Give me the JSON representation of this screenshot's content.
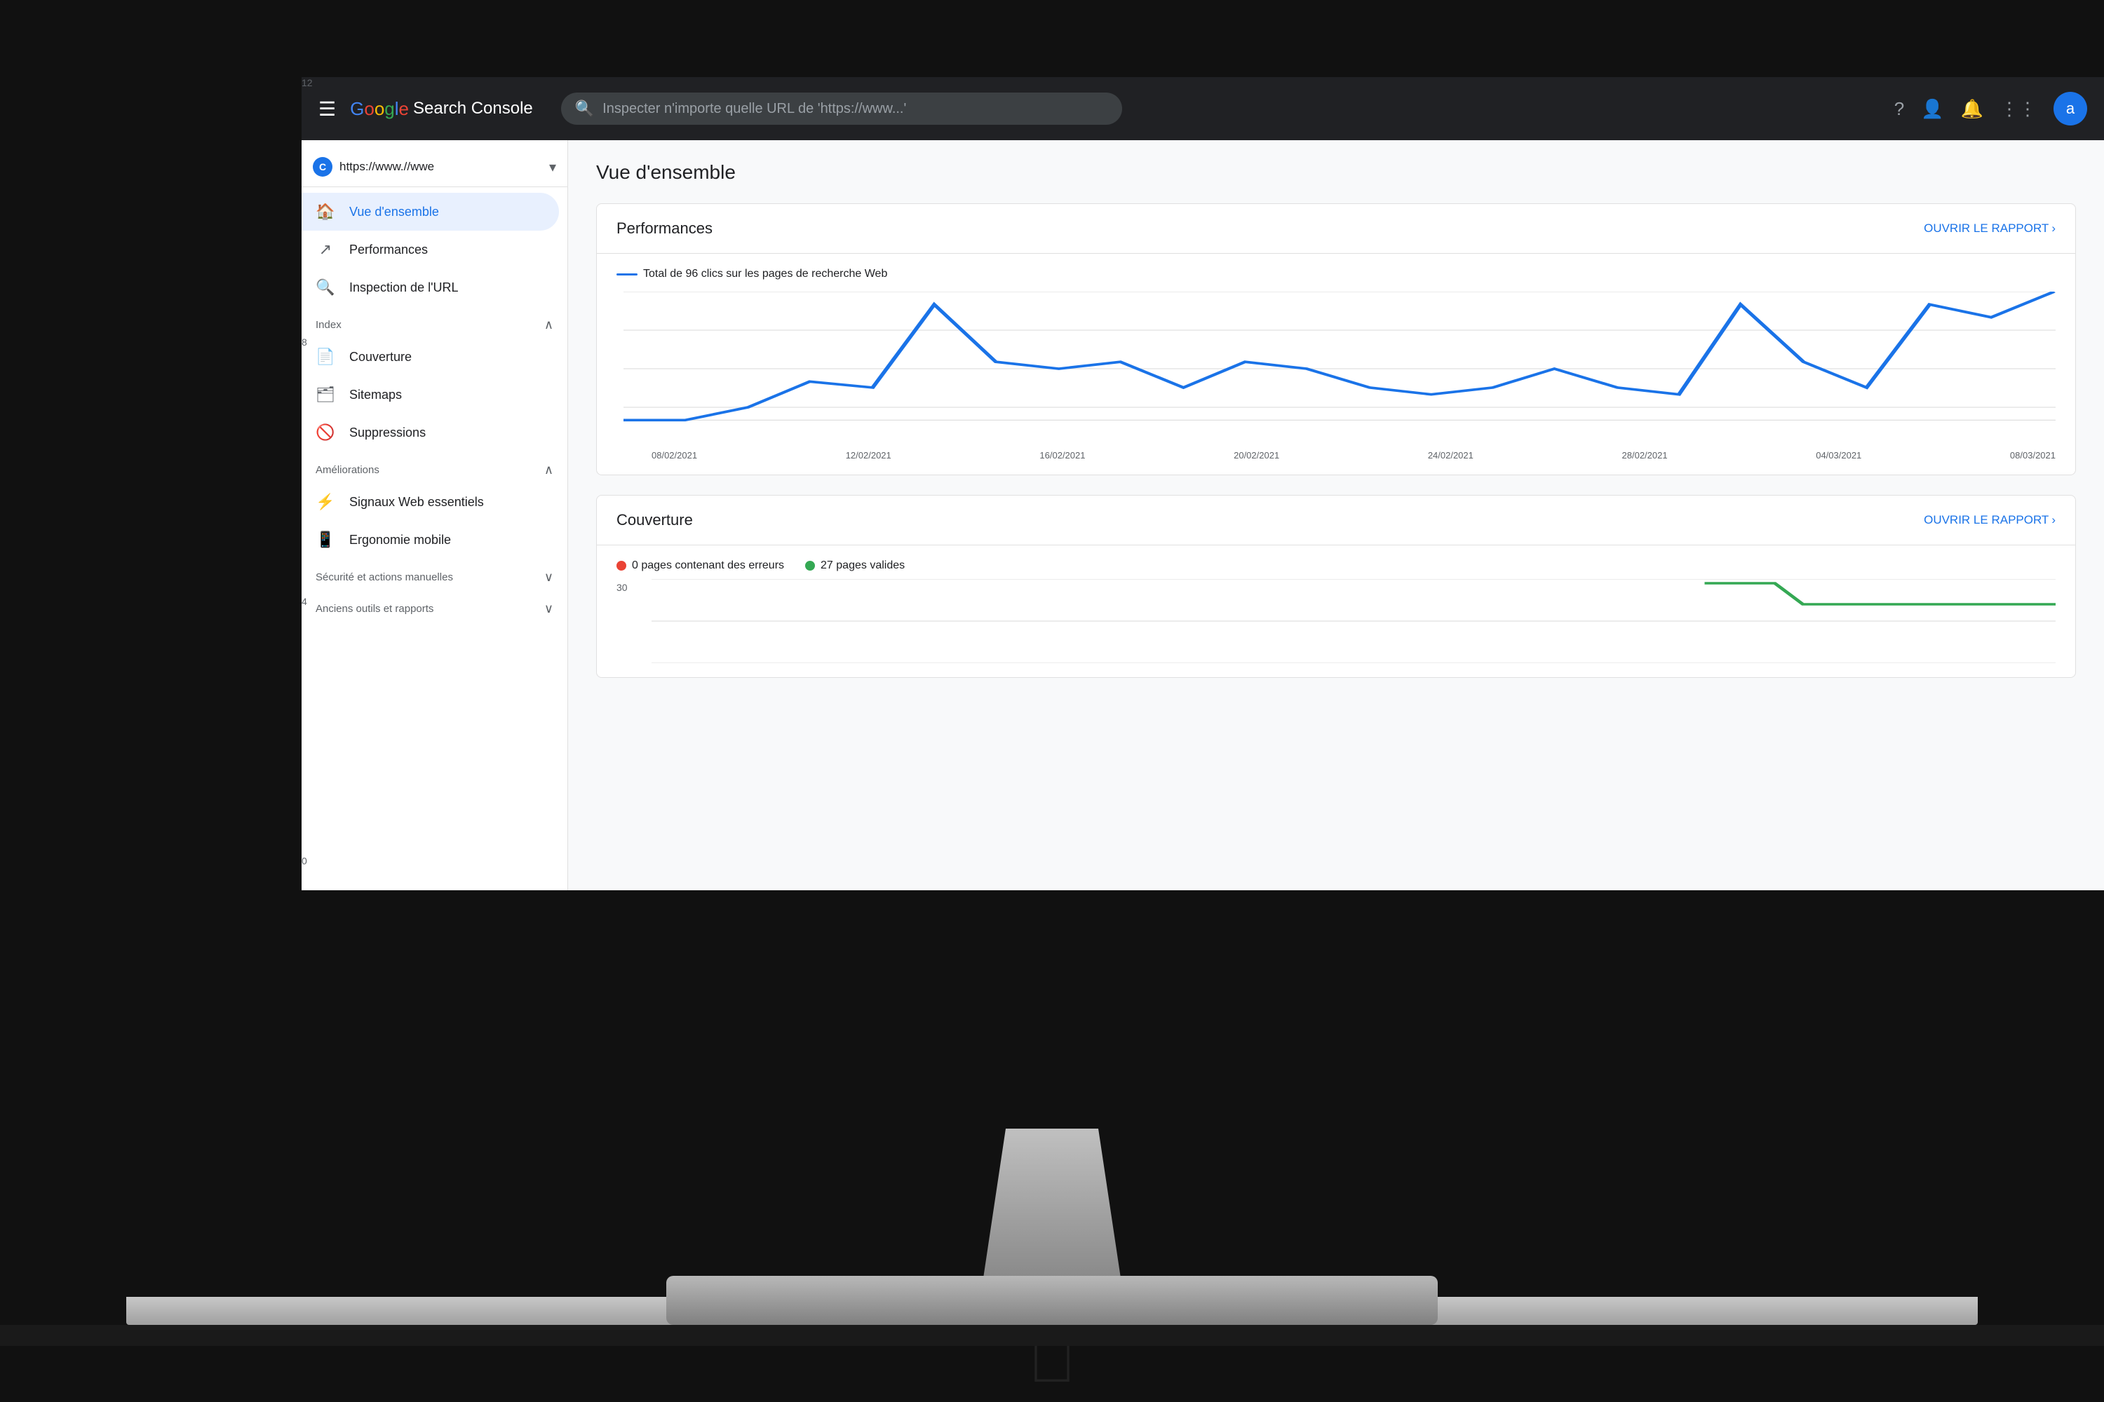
{
  "app": {
    "title": "Google Search Console",
    "logo_g": "G",
    "logo_search": "oogle ",
    "logo_sc": "Search Console",
    "search_placeholder": "Inspecter n'importe quelle URL de 'https://www...'",
    "avatar_letter": "a"
  },
  "topbar": {
    "icons": [
      "?",
      "👤",
      "🔔",
      "⋮⋮⋮"
    ]
  },
  "sidebar": {
    "property": {
      "url": "https://www.//wwe",
      "icon_letter": "C"
    },
    "nav_items": [
      {
        "id": "overview",
        "label": "Vue d'ensemble",
        "icon": "🏠",
        "active": true
      },
      {
        "id": "performances",
        "label": "Performances",
        "icon": "↗",
        "active": false
      },
      {
        "id": "url-inspection",
        "label": "Inspection de l'URL",
        "icon": "🔍",
        "active": false
      }
    ],
    "sections": [
      {
        "label": "Index",
        "items": [
          {
            "id": "coverage",
            "label": "Couverture",
            "icon": "📄"
          },
          {
            "id": "sitemaps",
            "label": "Sitemaps",
            "icon": "🗂"
          },
          {
            "id": "removals",
            "label": "Suppressions",
            "icon": "🚫"
          }
        ]
      },
      {
        "label": "Améliorations",
        "items": [
          {
            "id": "web-vitals",
            "label": "Signaux Web essentiels",
            "icon": "⚡"
          },
          {
            "id": "mobile",
            "label": "Ergonomie mobile",
            "icon": "📱"
          }
        ]
      },
      {
        "label": "Sécurité et actions manuelles",
        "items": []
      },
      {
        "label": "Anciens outils et rapports",
        "items": []
      }
    ]
  },
  "main": {
    "page_title": "Vue d'ensemble",
    "performances_card": {
      "title": "Performances",
      "link_label": "OUVRIR LE RAPPORT",
      "legend_label": "Total de 96 clics sur les pages de recherche Web",
      "legend_color": "#1a73e8",
      "y_labels": [
        "12",
        "8",
        "4",
        "0"
      ],
      "x_labels": [
        "08/02/2021",
        "12/02/2021",
        "16/02/2021",
        "20/02/2021",
        "24/02/2021",
        "28/02/2021",
        "04/03/2021",
        "08/03/2021"
      ],
      "chart_data": [
        0,
        0,
        1,
        4,
        3,
        8,
        5,
        4,
        5,
        3,
        5,
        4,
        3,
        2,
        3,
        4,
        3,
        2,
        9,
        5,
        3,
        9,
        7,
        12
      ]
    },
    "coverage_card": {
      "title": "Couverture",
      "link_label": "OUVRIR LE RAPPORT",
      "legend_error_label": "0 pages contenant des erreurs",
      "legend_error_color": "#ea4335",
      "legend_valid_label": "27 pages valides",
      "legend_valid_color": "#34a853",
      "y_labels": [
        "30"
      ],
      "chart_color_valid": "#34a853"
    }
  }
}
